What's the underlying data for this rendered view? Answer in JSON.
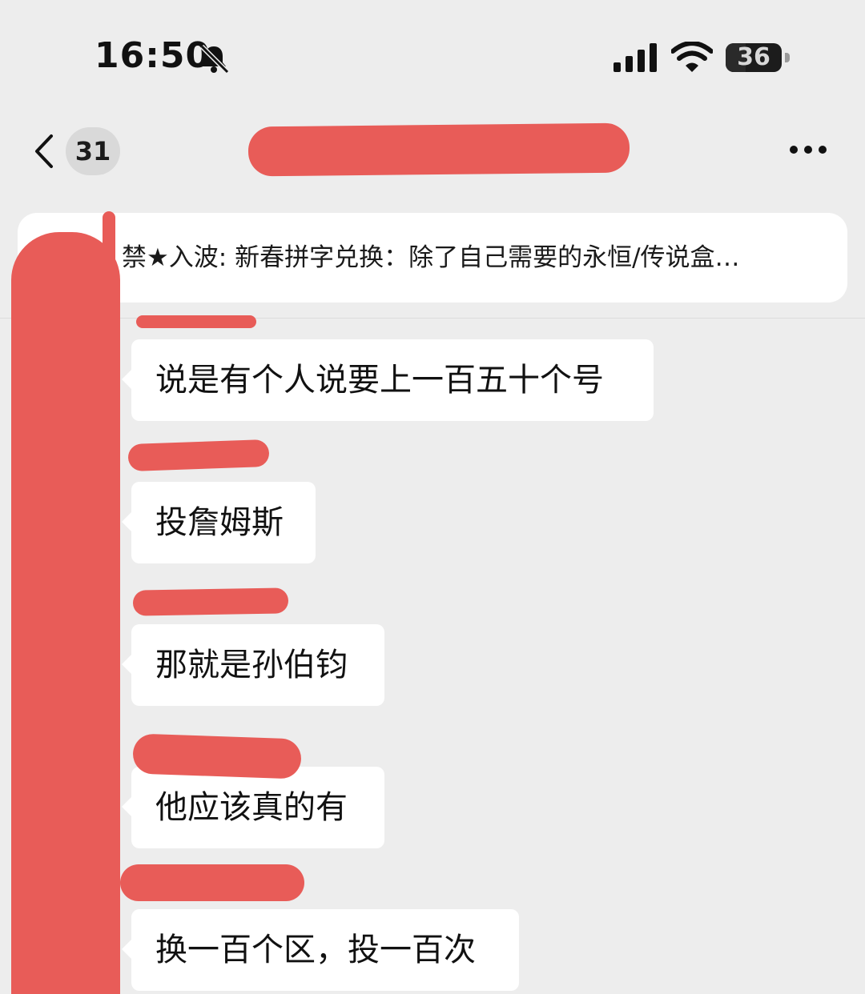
{
  "status_bar": {
    "time": "16:50",
    "battery_level": "36",
    "icons": [
      "bell-slash-icon",
      "cellular-signal-icon",
      "wifi-icon",
      "battery-icon"
    ]
  },
  "nav": {
    "unread_count": "31",
    "icons": [
      "chevron-left-icon",
      "more-icon"
    ]
  },
  "pinned": {
    "text": "禁★入波: 新春拼字兑换：除了自己需要的永恒/传说盒…"
  },
  "messages": [
    {
      "text": "说是有个人说要上一百五十个号"
    },
    {
      "text": "投詹姆斯"
    },
    {
      "text": "那就是孙伯钧"
    },
    {
      "text": "他应该真的有"
    },
    {
      "text": "换一百个区，投一百次"
    }
  ],
  "colors": {
    "background": "#ededed",
    "bubble": "#ffffff",
    "redaction": "#e85c58",
    "avatar_accent": "#f5c518"
  }
}
